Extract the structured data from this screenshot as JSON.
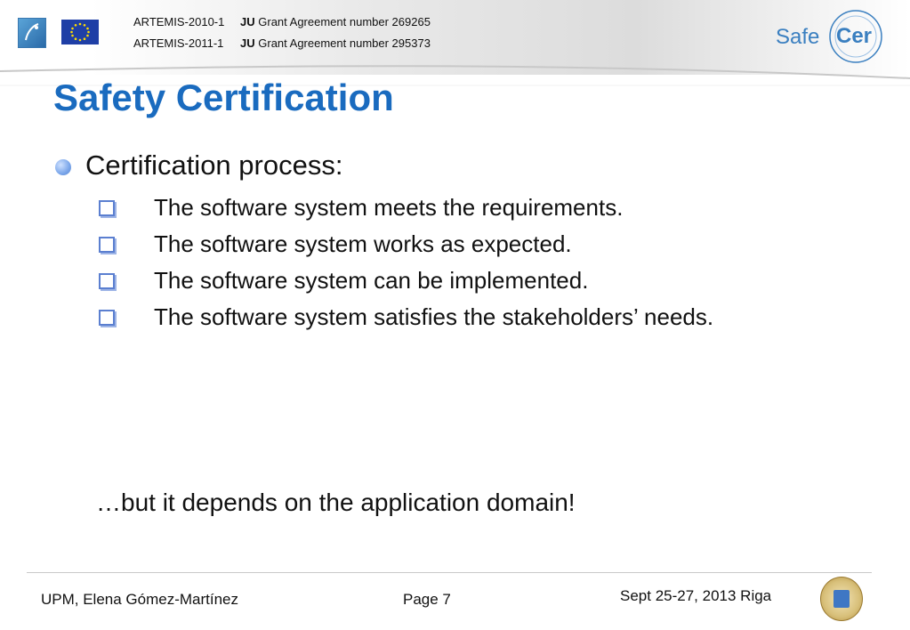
{
  "header": {
    "grants": [
      {
        "program": "ARTEMIS-2010-1",
        "ju": "JU",
        "agreement": "Grant Agreement number 269265"
      },
      {
        "program": "ARTEMIS-2011-1",
        "ju": "JU",
        "agreement": "Grant Agreement number 295373"
      }
    ],
    "logo_text": {
      "safe": "Safe",
      "cer": "Cer"
    },
    "icons": {
      "artemis": "artemis-logo-icon",
      "eu": "eu-flag-icon",
      "safecer": "safecer-logo-icon"
    }
  },
  "slide": {
    "title": "Safety Certification",
    "main_bullet": "Certification process:",
    "sub_bullets": [
      "The software system meets the requirements.",
      "The software system works as expected.",
      "The software system can be implemented.",
      "The software system satisfies the stakeholders’ needs."
    ],
    "note": "…but it depends on the application domain!"
  },
  "footer": {
    "author": "UPM, Elena Gómez-Martínez",
    "page": "Page 7",
    "event": "Sept 25-27, 2013 Riga",
    "seal_icon": "university-seal-icon"
  },
  "colors": {
    "title": "#1a6bbf",
    "bullet": "#7aa6ea",
    "sub_bullet_box": "#5b7fd0",
    "logo": "#3a7fc0"
  }
}
